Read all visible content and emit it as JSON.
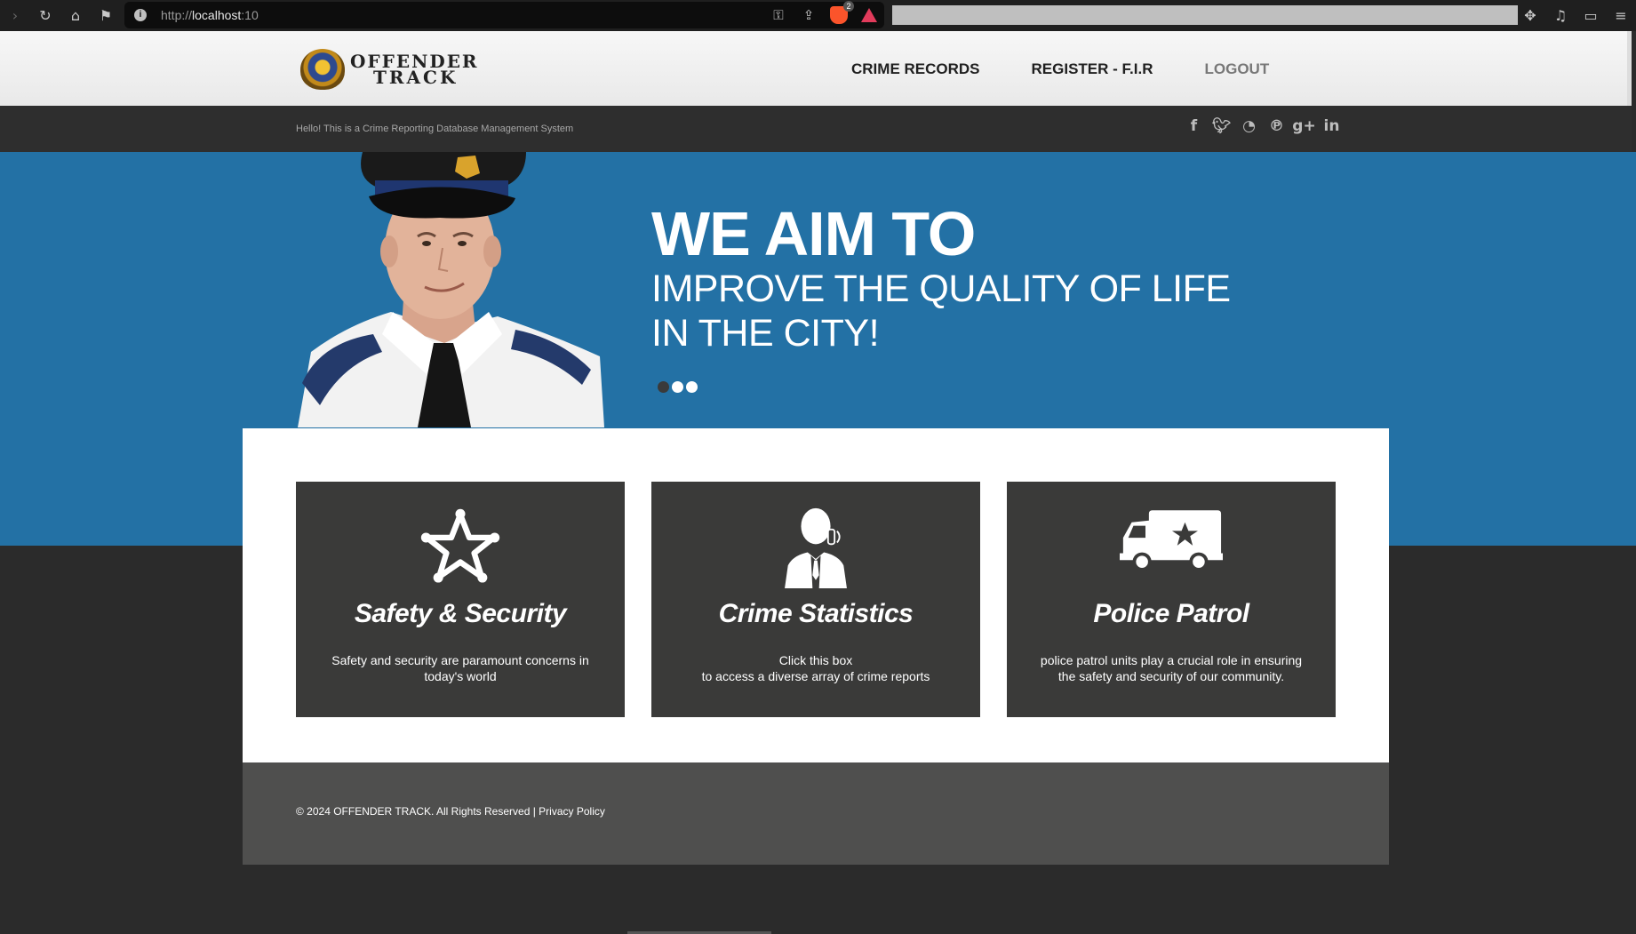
{
  "browser": {
    "url_scheme": "http://",
    "url_host": "localhost",
    "url_port": ":10",
    "shields_count": "2"
  },
  "header": {
    "logo_line1": "OFFENDER",
    "logo_line2": "TRACK",
    "nav": [
      {
        "label": "CRIME RECORDS"
      },
      {
        "label": "REGISTER - F.I.R"
      },
      {
        "label": "LOGOUT"
      }
    ]
  },
  "info_bar": {
    "tagline": "Hello! This is a Crime Reporting Database Management System",
    "socials": [
      "facebook-icon",
      "twitter-icon",
      "rss-icon",
      "pinterest-icon",
      "google-plus-icon",
      "linkedin-icon"
    ]
  },
  "hero": {
    "title": "WE AIM TO",
    "subtitle_line1": "IMPROVE THE QUALITY OF LIFE",
    "subtitle_line2": "IN THE CITY!",
    "slides": 3,
    "active_slide": 1
  },
  "cards": [
    {
      "icon": "sheriff-star-icon",
      "title": "Safety & Security",
      "text": "Safety and security are paramount concerns in\ntoday's world"
    },
    {
      "icon": "detective-icon",
      "title": "Crime Statistics",
      "text": "Click this box\nto access a diverse array of crime reports"
    },
    {
      "icon": "police-van-icon",
      "title": "Police Patrol",
      "text": "police patrol units play a crucial role in ensuring\nthe safety and security of our community."
    }
  ],
  "footer": {
    "copyright": "© 2024 OFFENDER TRACK. All Rights Reserved |",
    "privacy": "Privacy Policy"
  },
  "colors": {
    "hero_blue": "#2371a5",
    "card_dark": "#3a3a39",
    "footer_grey": "#4f4f4e"
  }
}
